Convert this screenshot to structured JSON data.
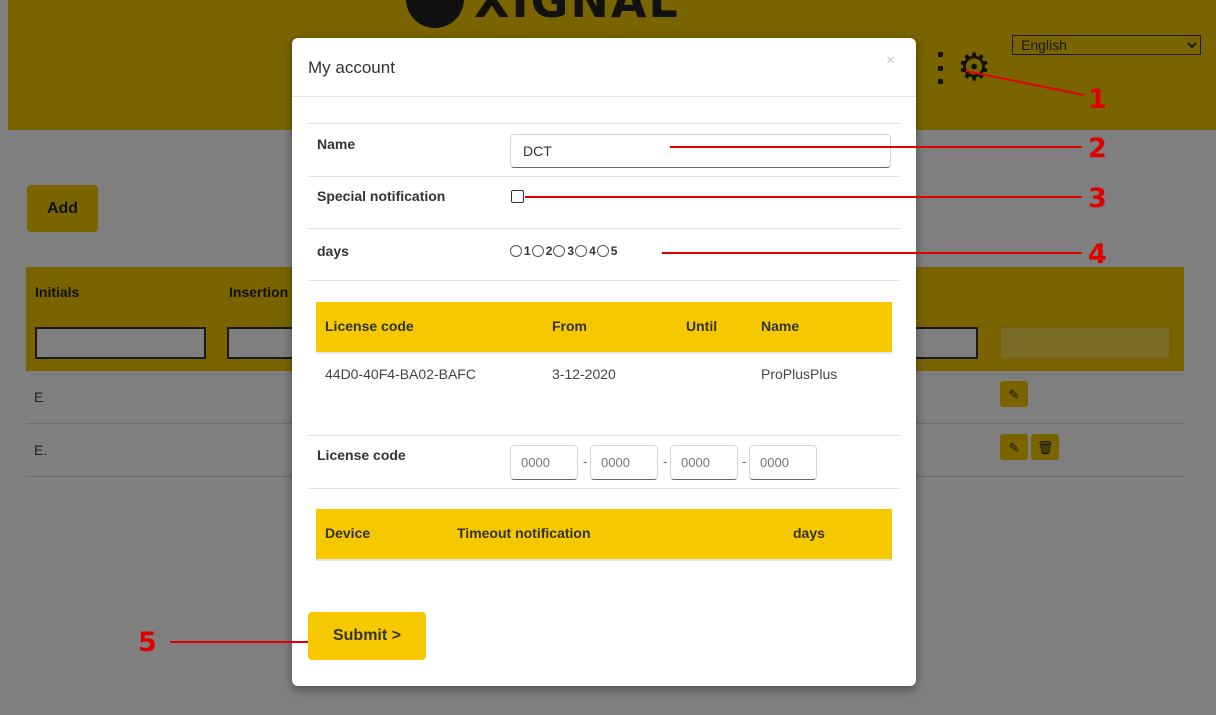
{
  "header": {
    "logo_text": "XIGNAL",
    "language": {
      "selected": "English",
      "options": [
        "English"
      ]
    }
  },
  "page": {
    "add_label": "Add",
    "columns": [
      "Initials",
      "Insertion"
    ],
    "rows": [
      {
        "initials": "E"
      },
      {
        "initials": "E."
      }
    ]
  },
  "modal": {
    "title": "My account",
    "close": "×",
    "fields": {
      "name_label": "Name",
      "name_value": "DCT",
      "special_label": "Special notification",
      "days_label": "days",
      "day_options": [
        "1",
        "2",
        "3",
        "4",
        "5"
      ]
    },
    "license_table": {
      "headers": [
        "License code",
        "From",
        "Until",
        "Name"
      ],
      "rows": [
        {
          "code": "44D0-40F4-BA02-BAFC",
          "from": "3-12-2020",
          "until": "",
          "name": "ProPlusPlus"
        }
      ]
    },
    "license_input": {
      "label": "License code",
      "placeholders": [
        "0000",
        "0000",
        "0000",
        "0000"
      ],
      "separator": "-"
    },
    "device_table": {
      "headers": [
        "Device",
        "Timeout notification",
        "days"
      ]
    },
    "submit_label": "Submit >"
  },
  "annotations": [
    "1",
    "2",
    "3",
    "4",
    "5"
  ],
  "colors": {
    "accent": "#f5c800",
    "annotation": "#e00000"
  }
}
